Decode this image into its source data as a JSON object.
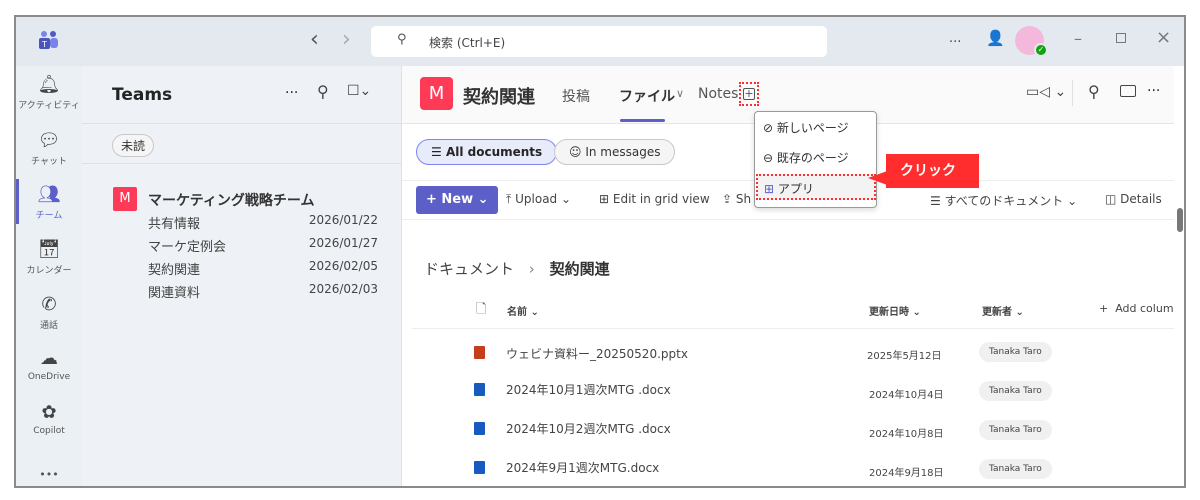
{
  "titlebar": {
    "search_placeholder": "検索 (Ctrl+E)",
    "more": "...",
    "nav_back": "‹",
    "nav_forward": "›"
  },
  "rail": [
    {
      "label": "アクティビティ",
      "icon": "bell-icon"
    },
    {
      "label": "チャット",
      "icon": "chat-icon"
    },
    {
      "label": "チーム",
      "icon": "teams-icon",
      "active": true
    },
    {
      "label": "カレンダー",
      "icon": "calendar-icon"
    },
    {
      "label": "通話",
      "icon": "phone-icon"
    },
    {
      "label": "OneDrive",
      "icon": "cloud-icon"
    },
    {
      "label": "Copilot",
      "icon": "copilot-icon"
    }
  ],
  "rail_more": "•••",
  "teams_panel": {
    "title": "Teams",
    "more": "···",
    "filter": "未読",
    "team": {
      "avatar": "M",
      "name": "マーケティング戦略チーム",
      "channels": [
        {
          "name": "共有情報",
          "date": "2026/01/22"
        },
        {
          "name": "マーケ定例会",
          "date": "2026/01/27"
        },
        {
          "name": "契約関連",
          "date": "2026/02/05"
        },
        {
          "name": "関連資料",
          "date": "2026/02/03"
        }
      ]
    }
  },
  "channel": {
    "avatar": "M",
    "name": "契約関連",
    "tabs": [
      {
        "label": "投稿"
      },
      {
        "label": "ファイル",
        "active": true
      },
      {
        "label": "Notes"
      }
    ],
    "tab_chevron": "∨",
    "header_more": "···"
  },
  "add_menu": {
    "items": [
      "新しいページ",
      "既存のページ",
      "アプリ"
    ]
  },
  "annotation": {
    "label": "クリック",
    "color": "#ff2d2d"
  },
  "views": {
    "all_documents": "All documents",
    "in_messages": "In messages"
  },
  "toolbar": {
    "new": "New",
    "upload": "Upload",
    "edit_grid": "Edit in grid view",
    "share": "Sh",
    "view_select": "すべてのドキュメント",
    "details": "Details"
  },
  "breadcrumb": {
    "root": "ドキュメント",
    "separator": "›",
    "current": "契約関連"
  },
  "table": {
    "headers": {
      "name": "名前",
      "modified": "更新日時",
      "modified_by": "更新者",
      "add_column": "Add column"
    },
    "rows": [
      {
        "name": "ウェビナ資料ー_20250520.pptx",
        "type": "pptx",
        "date": "2025年5月12日",
        "by": "Tanaka Taro"
      },
      {
        "name": "2024年10月1週次MTG .docx",
        "type": "docx",
        "date": "2024年10月4日",
        "by": "Tanaka Taro"
      },
      {
        "name": "2024年10月2週次MTG .docx",
        "type": "docx",
        "date": "2024年10月8日",
        "by": "Tanaka Taro"
      },
      {
        "name": "2024年9月1週次MTG.docx",
        "type": "docx",
        "date": "2024年9月18日",
        "by": "Tanaka Taro"
      }
    ]
  },
  "colors": {
    "accent": "#5b5fc7",
    "team_avatar": "#ff3a57",
    "presence": "#13a10e"
  }
}
